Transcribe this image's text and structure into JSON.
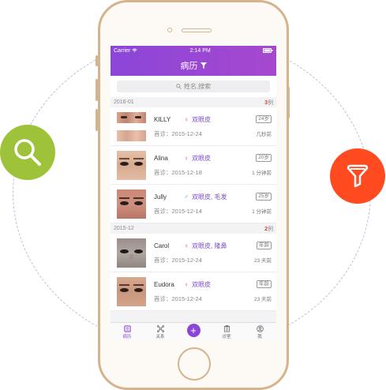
{
  "status_bar": {
    "carrier": "Carrier",
    "time": "2:14 PM"
  },
  "nav": {
    "title": "病历"
  },
  "search": {
    "placeholder": "姓名,搜索"
  },
  "sections": [
    {
      "date": "2016-01",
      "count_num": "3",
      "count_unit": "例"
    },
    {
      "date": "2015-12",
      "count_num": "2",
      "count_unit": "例"
    }
  ],
  "records": [
    {
      "name": "KILLY",
      "gender": "♀",
      "tags": "双眼皮",
      "age": "24岁",
      "first_visit": "首诊：2015-12-24",
      "ago": "几秒前"
    },
    {
      "name": "Alina",
      "gender": "♀",
      "tags": "双眼皮",
      "age": "20岁",
      "first_visit": "首诊：2015-12-18",
      "ago": "1 分钟前"
    },
    {
      "name": "Jully",
      "gender": "♂",
      "tags": "双眼皮, 毛发",
      "age": "25岁",
      "first_visit": "首诊：2015-12-14",
      "ago": "1 分钟前"
    },
    {
      "name": "Carol",
      "gender": "♀",
      "tags": "双眼皮, 隆鼻",
      "age": "年龄",
      "first_visit": "首诊：2015-12-24",
      "ago": "23 天前"
    },
    {
      "name": "Eudora",
      "gender": "♀",
      "tags": "双眼皮",
      "age": "年龄",
      "first_visit": "首诊：2015-12-24",
      "ago": "23 天前"
    }
  ],
  "tabbar": {
    "tabs": [
      {
        "label": "病历"
      },
      {
        "label": "关系"
      },
      {
        "label": "+"
      },
      {
        "label": "诊室"
      },
      {
        "label": "我"
      }
    ]
  },
  "colors": {
    "accent": "#8b46d8",
    "search_circle": "#9ec23a",
    "filter_circle": "#ff4b1f",
    "phone_frame": "#d4b48c"
  }
}
